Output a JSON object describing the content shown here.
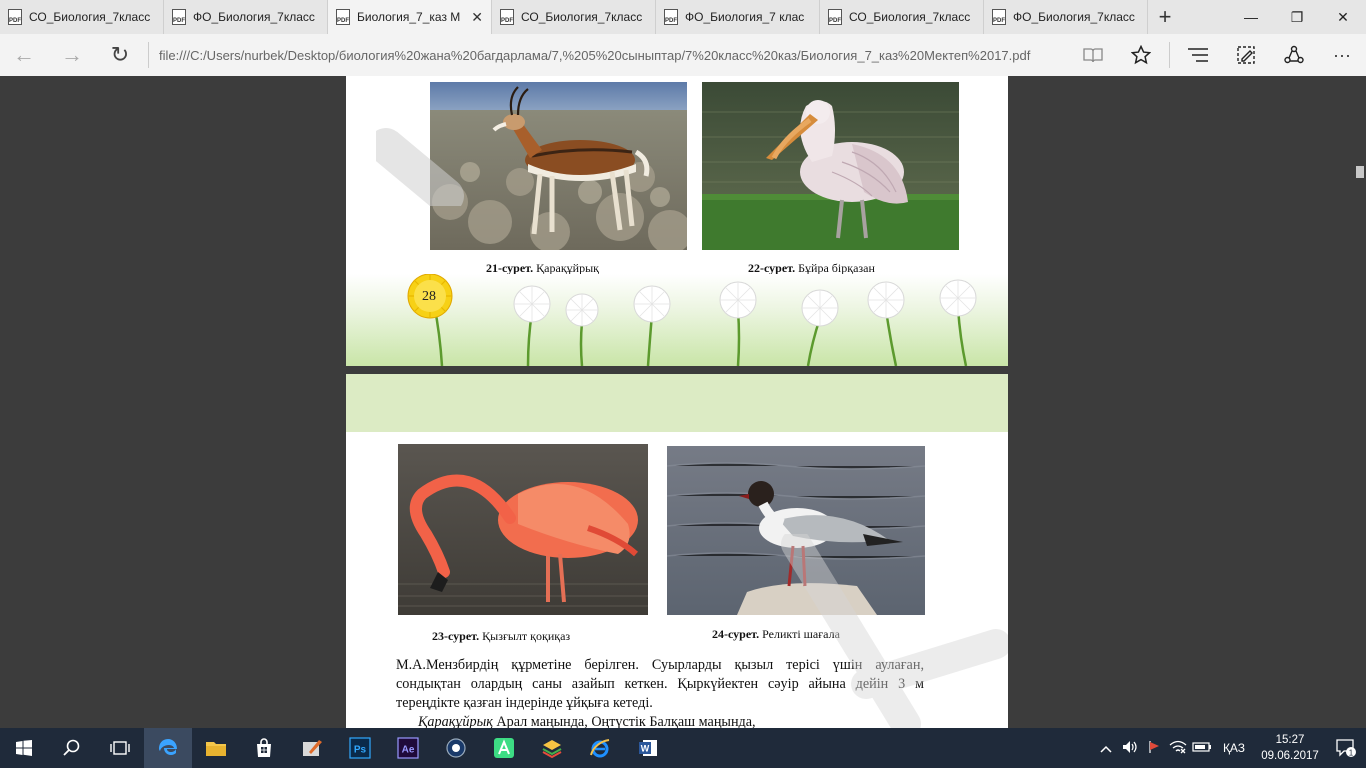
{
  "tabs": [
    {
      "title": "СО_Биология_7класс",
      "active": false
    },
    {
      "title": "ФО_Биология_7класс",
      "active": false
    },
    {
      "title": "Биология_7_каз М",
      "active": true
    },
    {
      "title": "СО_Биология_7класс",
      "active": false
    },
    {
      "title": "ФО_Биология_7 клас",
      "active": false
    },
    {
      "title": "СО_Биология_7класс",
      "active": false
    },
    {
      "title": "ФО_Биология_7класс",
      "active": false
    }
  ],
  "tab_icon_label": "PDF",
  "newtab_glyph": "+",
  "window_controls": {
    "minimize": "—",
    "maximize": "❐",
    "close": "✕"
  },
  "nav": {
    "back": "←",
    "forward": "→",
    "refresh": "↻"
  },
  "address": {
    "url": "file:///C:/Users/nurbek/Desktop/биология%20жана%20багдарлама/7,%205%20сыныптар/7%20класс%20каз/Биология_7_каз%20Мектеп%2017.pdf"
  },
  "toolbar_glyphs": {
    "reading": "📖",
    "favorite": "☆",
    "hub": "≡",
    "notes": "✎",
    "share": "⇪",
    "more": "···"
  },
  "page1": {
    "captions": [
      {
        "num": "21-сурет.",
        "text": "Қарақұйрық"
      },
      {
        "num": "22-сурет.",
        "text": "Бұйра бірқазан"
      }
    ],
    "page_number": "28"
  },
  "page2": {
    "captions": [
      {
        "num": "23-сурет.",
        "text": "Қызғылт қоқиқаз"
      },
      {
        "num": "24-сурет.",
        "text": "Реликті шағала"
      }
    ],
    "paragraph1": "М.А.Мензбирдің құрметіне берілген. Суырларды қызыл терісі үшін аулаған, сондықтан олардың саны азайып кеткен. Қыркүйектен сәуір айына дейін 3 м тереңдікте қазған індерінде ұйқыға кетеді.",
    "paragraph2_italic": "Қарақұйрық",
    "paragraph2_rest": " Арал маңында, Оңтүстік Балқаш маңында,"
  },
  "taskbar": {
    "ps_label": "Ps",
    "ae_label": "Ae",
    "word_label": "W",
    "language": "ҚАЗ",
    "time": "15:27",
    "date": "09.06.2017",
    "notif_count": "1"
  },
  "colors": {
    "accent": "#0078d7",
    "taskbar": "#1f2a3a",
    "viewer_bg": "#3c3c3c",
    "meadow_green": "#c9e5a8"
  }
}
